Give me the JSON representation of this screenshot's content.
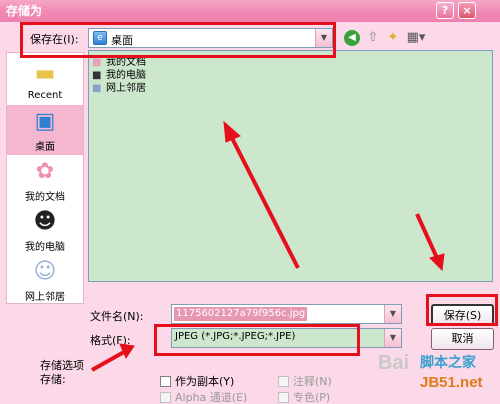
{
  "window": {
    "title": "存储为",
    "help_label": "?",
    "close_label": "×"
  },
  "lookin": {
    "label": "保存在(I):",
    "value": "桌面"
  },
  "toolbar": {
    "back_icon": "back-arrow-icon",
    "up_icon": "up-folder-icon",
    "newfolder_icon": "new-folder-icon",
    "views_icon": "views-menu-icon"
  },
  "places": [
    {
      "label": "Recent",
      "icon": "recent-folder-icon"
    },
    {
      "label": "桌面",
      "icon": "desktop-icon"
    },
    {
      "label": "我的文档",
      "icon": "my-documents-icon"
    },
    {
      "label": "我的电脑",
      "icon": "my-computer-icon"
    },
    {
      "label": "网上邻居",
      "icon": "network-icon"
    }
  ],
  "files": [
    {
      "name": "我的文档"
    },
    {
      "name": "我的电脑"
    },
    {
      "name": "网上邻居"
    }
  ],
  "filename": {
    "label": "文件名(N):",
    "value": "1175602127a79f956c.jpg"
  },
  "format": {
    "label": "格式(F):",
    "value": "JPEG (*.JPG;*.JPEG;*.JPE)"
  },
  "buttons": {
    "save": "保存(S)",
    "cancel": "取消"
  },
  "options": {
    "label": "存储选项",
    "label2": "存储:",
    "as_copy": "作为副本(Y)",
    "alpha": "Alpha 通道(E)",
    "notes": "注释(N)",
    "spot": "专色(P)"
  },
  "watermark": {
    "text": "Bai",
    "site1": "脚本之家",
    "site2": "JB51.net"
  },
  "colors": {
    "highlight": "#e6101c",
    "list_bg": "#cde7cd",
    "titlebar": "#ee7fae"
  }
}
